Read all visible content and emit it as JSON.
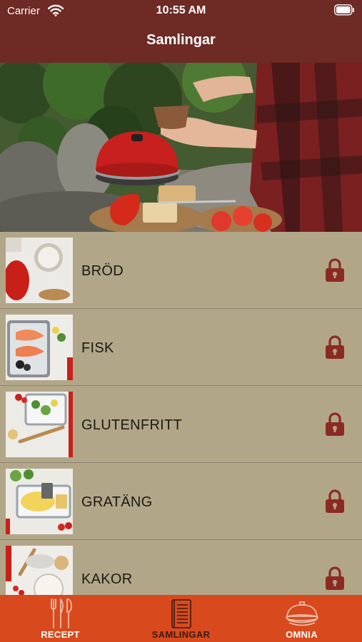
{
  "status_bar": {
    "carrier": "Carrier",
    "time": "10:55 AM"
  },
  "nav": {
    "title": "Samlingar"
  },
  "collections": [
    {
      "label": "BRÖD",
      "locked": true
    },
    {
      "label": "FISK",
      "locked": true
    },
    {
      "label": "GLUTENFRITT",
      "locked": true
    },
    {
      "label": "GRATÄNG",
      "locked": true
    },
    {
      "label": "KAKOR",
      "locked": true
    }
  ],
  "tabs": [
    {
      "label": "RECEPT",
      "icon": "cutlery-icon",
      "active": false
    },
    {
      "label": "SAMLINGAR",
      "icon": "book-icon",
      "active": true
    },
    {
      "label": "OMNIA",
      "icon": "omnia-oven-icon",
      "active": false
    }
  ],
  "colors": {
    "bar": "#6e2a24",
    "tab_bar": "#d84a1e",
    "list_bg": "#b2a689",
    "lock": "#8c2a22",
    "tab_active": "#3b1a14"
  }
}
